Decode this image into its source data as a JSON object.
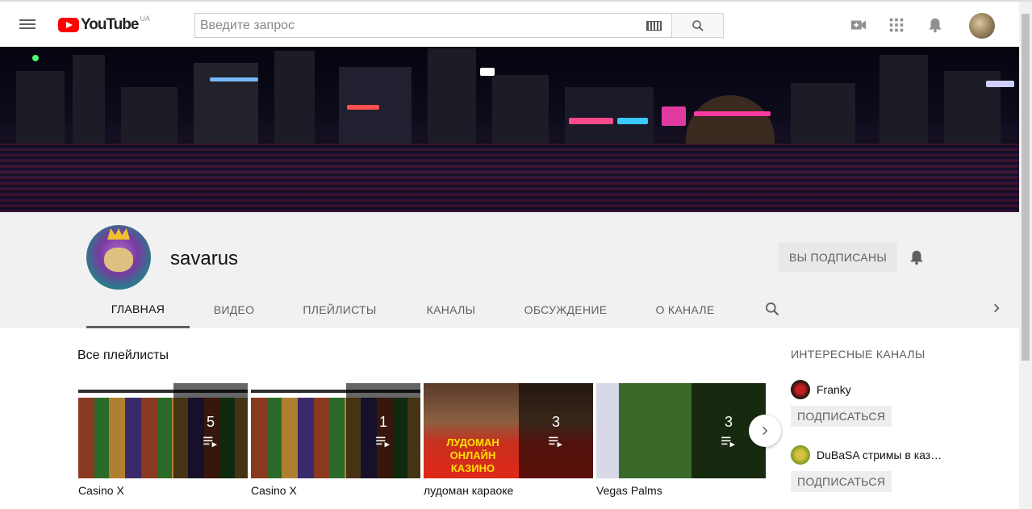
{
  "masthead": {
    "logo_text": "YouTube",
    "logo_country": "UA",
    "search_placeholder": "Введите запрос",
    "icons": [
      "menu-icon",
      "keyboard-icon",
      "search-icon",
      "video-camera-icon",
      "apps-icon",
      "bell-icon"
    ]
  },
  "channel": {
    "name": "savarus",
    "subscribe_label": "ВЫ ПОДПИСАНЫ"
  },
  "tabs": [
    {
      "label": "ГЛАВНАЯ",
      "active": true
    },
    {
      "label": "ВИДЕО"
    },
    {
      "label": "ПЛЕЙЛИСТЫ"
    },
    {
      "label": "КАНАЛЫ"
    },
    {
      "label": "ОБСУЖДЕНИЕ"
    },
    {
      "label": "О КАНАЛЕ"
    }
  ],
  "section": {
    "title": "Все плейлисты",
    "playlists": [
      {
        "title": "Casino X",
        "count": "5"
      },
      {
        "title": "Casino X",
        "count": "1"
      },
      {
        "title": "лудоман караоке",
        "count": "3",
        "thumb_text": "ЛУДОМАН ОНЛАЙН КАЗИНО"
      },
      {
        "title": "Vegas Palms",
        "count": "3"
      }
    ]
  },
  "sidebar": {
    "title": "ИНТЕРЕСНЫЕ КАНАЛЫ",
    "channels": [
      {
        "name": "Franky",
        "subscribe_label": "ПОДПИСАТЬСЯ"
      },
      {
        "name": "DuBaSA стримы в казино",
        "subscribe_label": "ПОДПИСАТЬСЯ"
      }
    ]
  },
  "colors": {
    "brand_red": "#ff0000",
    "text_primary": "#111111",
    "text_secondary": "#606060"
  }
}
